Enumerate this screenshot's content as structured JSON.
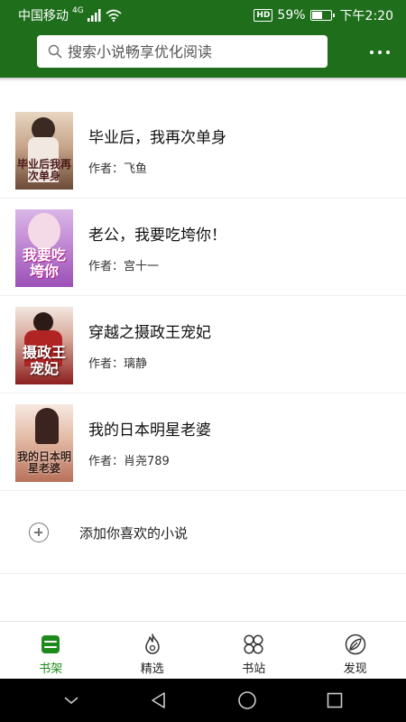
{
  "status": {
    "carrier": "中国移动",
    "signal_type": "4G",
    "battery": "59%",
    "battery_level": 0.59,
    "time": "下午2:20",
    "hd": "HD"
  },
  "search": {
    "placeholder": "搜索小说畅享优化阅读"
  },
  "books": [
    {
      "title": "毕业后，我再次单身",
      "author_label": "作者：",
      "author": "飞鱼",
      "cover_text": "毕业后我再次单身"
    },
    {
      "title": "老公，我要吃垮你！",
      "author_label": "作者：",
      "author": "宫十一",
      "cover_text": "我要吃垮你"
    },
    {
      "title": "穿越之摄政王宠妃",
      "author_label": "作者：",
      "author": "璃静",
      "cover_text": "摄政王宠妃"
    },
    {
      "title": "我的日本明星老婆",
      "author_label": "作者：",
      "author": "肖尧789",
      "cover_text": "我的日本明星老婆"
    }
  ],
  "add_label": "添加你喜欢的小说",
  "tabs": [
    {
      "label": "书架",
      "icon": "bookshelf-icon",
      "active": true
    },
    {
      "label": "精选",
      "icon": "flame-icon",
      "active": false
    },
    {
      "label": "书站",
      "icon": "grid-icon",
      "active": false
    },
    {
      "label": "发现",
      "icon": "leaf-icon",
      "active": false
    }
  ],
  "colors": {
    "primary": "#1f6e1c",
    "tab_active": "#1f8a1c"
  }
}
